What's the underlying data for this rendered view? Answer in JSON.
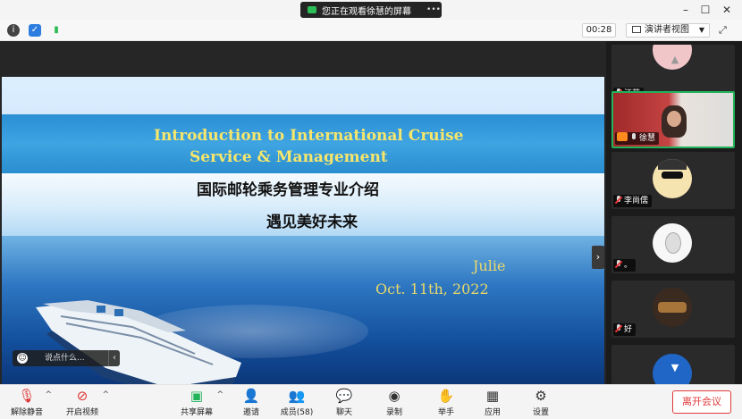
{
  "top_bar": {
    "viewing_text": "您正在观看徐慧的屏幕",
    "window_controls": [
      "minimize",
      "maximize",
      "close"
    ]
  },
  "info_bar": {
    "icons": [
      "info-icon",
      "shield-icon",
      "signal-icon"
    ],
    "timer": "00:28",
    "view_mode": "演讲者视图"
  },
  "slide": {
    "title_line1": "Introduction to International Cruise",
    "title_line2": "Service & Management",
    "cn_title": "国际邮轮乘务管理专业介绍",
    "cn_subtitle": "遇见美好未来",
    "author": "Julie",
    "date": "Oct. 11th, 2022"
  },
  "chat_input": {
    "placeholder": "说点什么..."
  },
  "participants": [
    {
      "name": "汪荷",
      "muted": true,
      "host": false
    },
    {
      "name": "徐慧",
      "muted": false,
      "host": true,
      "active": true
    },
    {
      "name": "李尚儒",
      "muted": true,
      "host": false
    },
    {
      "name": "。",
      "muted": true,
      "host": false
    },
    {
      "name": "好",
      "muted": true,
      "host": false
    },
    {
      "name": "",
      "muted": true,
      "host": false
    }
  ],
  "toolbar": {
    "unmute": "解除静音",
    "start_video": "开启视频",
    "share_screen": "共享屏幕",
    "invite": "邀请",
    "members": "成员(58)",
    "chat": "聊天",
    "record": "录制",
    "raise_hand": "举手",
    "apps": "应用",
    "settings": "设置",
    "leave": "离开会议"
  },
  "colors": {
    "accent_green": "#20b35a",
    "leave_red": "#e03a3a",
    "slide_title_yellow": "#f6e66b"
  }
}
